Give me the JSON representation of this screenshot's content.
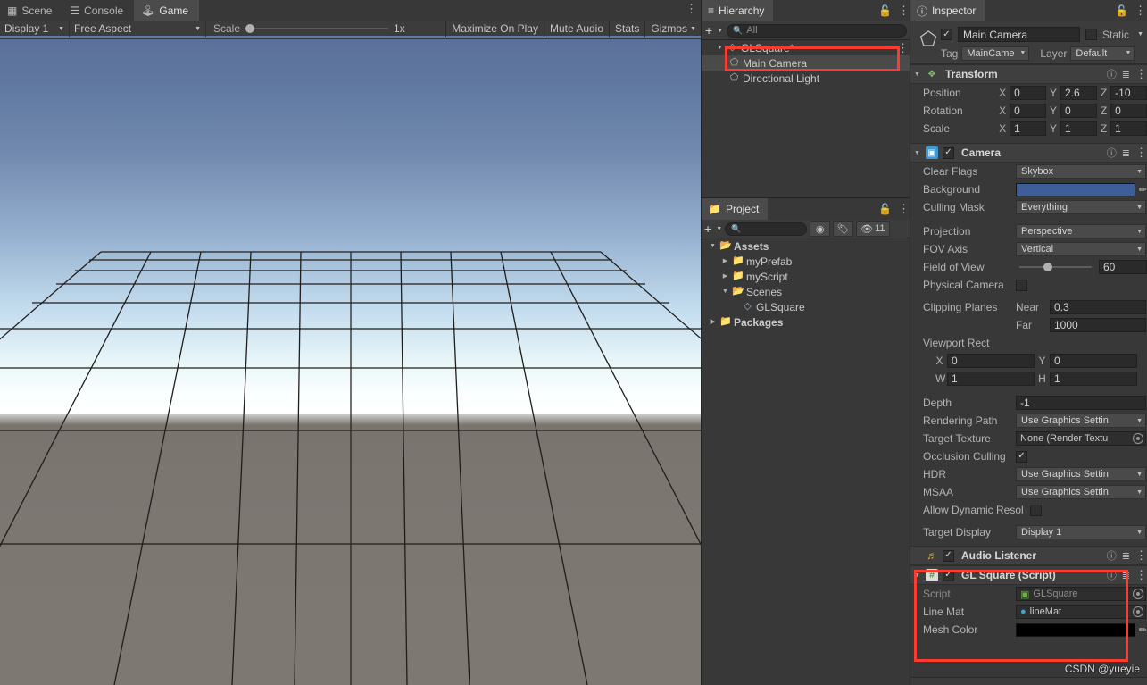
{
  "game_view": {
    "tabs": [
      {
        "label": "Scene",
        "icon": "grid-icon",
        "active": false
      },
      {
        "label": "Console",
        "icon": "console-icon",
        "active": false
      },
      {
        "label": "Game",
        "icon": "gamepad-icon",
        "active": true
      }
    ],
    "toolbar": {
      "display": "Display 1",
      "aspect": "Free Aspect",
      "scale_label": "Scale",
      "scale_value": "1x",
      "maximize_on_play": "Maximize On Play",
      "mute_audio": "Mute Audio",
      "stats": "Stats",
      "gizmos": "Gizmos"
    },
    "scene": {
      "sky_top_color": "#5b7098",
      "sky_horizon_color": "#ffffff",
      "ground_color": "#7d7772",
      "grid_line_color": "#1f1b18",
      "grid_divisions": 10
    }
  },
  "hierarchy": {
    "tab_label": "Hierarchy",
    "search_placeholder": "All",
    "add_label": "+",
    "items": [
      {
        "label": "GLSquare*",
        "icon": "unity-scene-icon",
        "depth": 0,
        "expanded": true,
        "selected": false
      },
      {
        "label": "Main Camera",
        "icon": "gameobject-icon",
        "depth": 1,
        "expanded": false,
        "selected": true
      },
      {
        "label": "Directional Light",
        "icon": "gameobject-icon",
        "depth": 1,
        "expanded": false,
        "selected": false
      }
    ]
  },
  "project": {
    "tab_label": "Project",
    "search_placeholder": "",
    "hidden_count": "11",
    "items": [
      {
        "label": "Assets",
        "icon": "folder-open-icon",
        "depth": 0,
        "expanded": true,
        "bold": true
      },
      {
        "label": "myPrefab",
        "icon": "folder-icon",
        "depth": 1,
        "expanded": false,
        "bold": false
      },
      {
        "label": "myScript",
        "icon": "folder-icon",
        "depth": 1,
        "expanded": false,
        "bold": false
      },
      {
        "label": "Scenes",
        "icon": "folder-open-icon",
        "depth": 1,
        "expanded": true,
        "bold": false
      },
      {
        "label": "GLSquare",
        "icon": "unity-scene-icon",
        "depth": 2,
        "expanded": null,
        "bold": false
      },
      {
        "label": "Packages",
        "icon": "folder-icon",
        "depth": 0,
        "expanded": false,
        "bold": true
      }
    ]
  },
  "inspector": {
    "tab_label": "Inspector",
    "object": {
      "name": "Main Camera",
      "enabled": true,
      "static_label": "Static",
      "tag_label": "Tag",
      "tag_value": "MainCame",
      "layer_label": "Layer",
      "layer_value": "Default"
    },
    "transform": {
      "title": "Transform",
      "position_label": "Position",
      "rotation_label": "Rotation",
      "scale_label": "Scale",
      "position": {
        "x": "0",
        "y": "2.6",
        "z": "-10"
      },
      "rotation": {
        "x": "0",
        "y": "0",
        "z": "0"
      },
      "scale": {
        "x": "1",
        "y": "1",
        "z": "1"
      }
    },
    "camera": {
      "title": "Camera",
      "enabled": true,
      "clear_flags_label": "Clear Flags",
      "clear_flags_value": "Skybox",
      "background_label": "Background",
      "background_color": "#3d5e96",
      "culling_mask_label": "Culling Mask",
      "culling_mask_value": "Everything",
      "projection_label": "Projection",
      "projection_value": "Perspective",
      "fov_axis_label": "FOV Axis",
      "fov_axis_value": "Vertical",
      "field_of_view_label": "Field of View",
      "field_of_view_value": "60",
      "physical_camera_label": "Physical Camera",
      "physical_camera_checked": false,
      "clipping_planes_label": "Clipping Planes",
      "near_label": "Near",
      "near_value": "0.3",
      "far_label": "Far",
      "far_value": "1000",
      "viewport_rect_label": "Viewport Rect",
      "viewport": {
        "x": "0",
        "y": "0",
        "w": "1",
        "h": "1"
      },
      "depth_label": "Depth",
      "depth_value": "-1",
      "rendering_path_label": "Rendering Path",
      "rendering_path_value": "Use Graphics Settin",
      "target_texture_label": "Target Texture",
      "target_texture_value": "None (Render Textu",
      "occlusion_culling_label": "Occlusion Culling",
      "occlusion_culling_checked": true,
      "hdr_label": "HDR",
      "hdr_value": "Use Graphics Settin",
      "msaa_label": "MSAA",
      "msaa_value": "Use Graphics Settin",
      "allow_dynamic_label": "Allow Dynamic Resol",
      "allow_dynamic_checked": false,
      "target_display_label": "Target Display",
      "target_display_value": "Display 1"
    },
    "audio_listener": {
      "title": "Audio Listener",
      "enabled": true,
      "icon_color": "#e8a317"
    },
    "gl_square": {
      "title": "GL Square (Script)",
      "enabled": true,
      "icon_color": "#88c057",
      "script_label": "Script",
      "script_value": "GLSquare",
      "line_mat_label": "Line Mat",
      "line_mat_value": "lineMat",
      "mesh_color_label": "Mesh Color",
      "mesh_color_value": "#000000"
    }
  },
  "annotations": {
    "highlight_color": "#ff3b30",
    "watermark": "CSDN @yueyie"
  }
}
